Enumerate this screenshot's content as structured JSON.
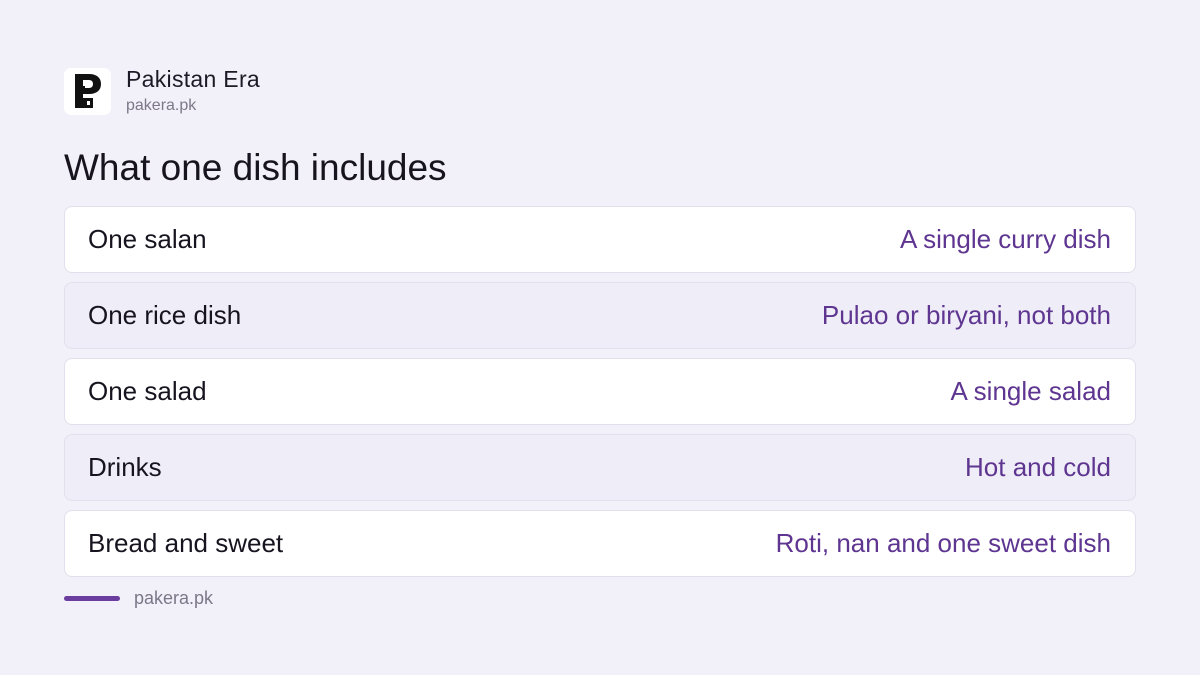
{
  "brand": {
    "name": "Pakistan Era",
    "domain": "pakera.pk",
    "logo_icon": "pakistan-era-logo"
  },
  "title": "What one dish includes",
  "rows": [
    {
      "label": "One salan",
      "value": "A single curry dish"
    },
    {
      "label": "One rice dish",
      "value": "Pulao or biryani, not both"
    },
    {
      "label": "One salad",
      "value": "A single salad"
    },
    {
      "label": "Drinks",
      "value": "Hot and cold"
    },
    {
      "label": "Bread and sweet",
      "value": "Roti, nan and one sweet dish"
    }
  ],
  "footer": {
    "text": "pakera.pk"
  },
  "colors": {
    "background": "#f2f0f8",
    "accent": "#6a3d9e",
    "value_text": "#5e3590"
  }
}
